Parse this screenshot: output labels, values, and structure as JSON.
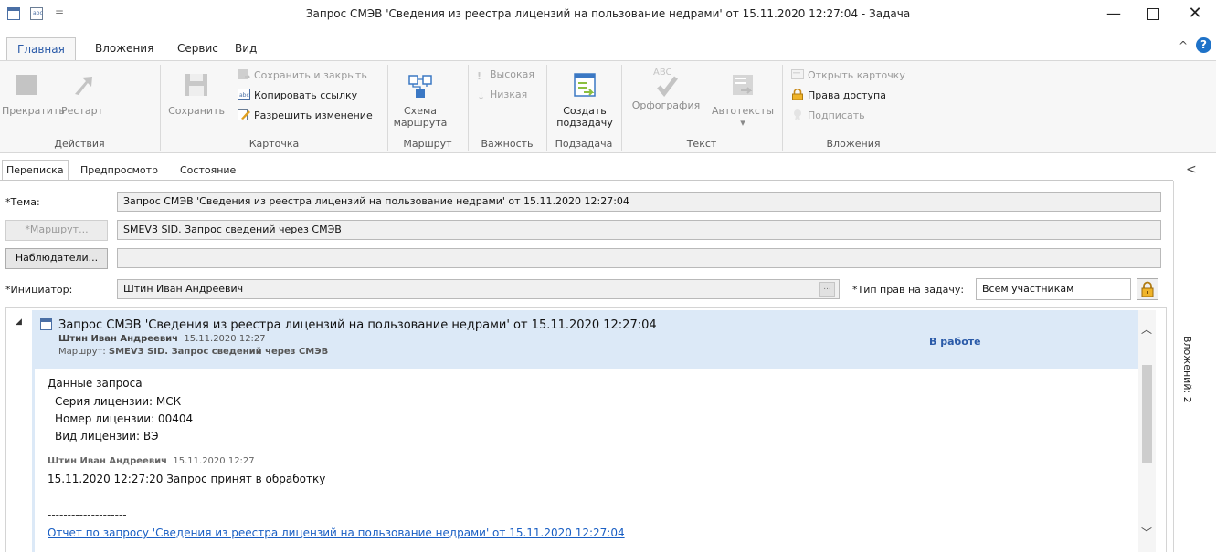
{
  "window": {
    "title": "Запрос СМЭВ 'Сведения из реестра лицензий на пользование недрами' от 15.11.2020 12:27:04 - Задача",
    "qa_separator": "=",
    "minimize": "—",
    "close": "✕"
  },
  "ribbon_tabs": [
    "Главная",
    "Вложения",
    "Сервис",
    "Вид"
  ],
  "ribbon_collapse": "^",
  "help": "?",
  "ribbon": {
    "actions": {
      "stop": "Прекратить",
      "restart": "Рестарт",
      "label": "Действия"
    },
    "card": {
      "save": "Сохранить",
      "save_close": "Сохранить и закрыть",
      "copy_link": "Копировать ссылку",
      "allow_change": "Разрешить изменение",
      "label": "Карточка"
    },
    "route": {
      "scheme_line1": "Схема",
      "scheme_line2": "маршрута",
      "label": "Маршрут"
    },
    "importance": {
      "high": "Высокая",
      "low": "Низкая",
      "label": "Важность"
    },
    "subtask": {
      "create_line1": "Создать",
      "create_line2": "подзадачу",
      "label": "Подзадача"
    },
    "text": {
      "abc": "ABC",
      "spelling": "Орфография",
      "autotext": "Автотексты",
      "autotext_arrow": "▾",
      "label": "Текст"
    },
    "attachments": {
      "open_card": "Открыть карточку",
      "access_rights": "Права доступа",
      "sign": "Подписать",
      "label": "Вложения"
    }
  },
  "content_tabs": [
    "Переписка",
    "Предпросмотр",
    "Состояние"
  ],
  "collapse_arrow": "<",
  "form": {
    "subject_label": "*Тема:",
    "subject_value": "Запрос СМЭВ 'Сведения из реестра лицензий на пользование недрами' от 15.11.2020 12:27:04",
    "route_button": "*Маршрут...",
    "route_value": "SMEV3 SID. Запрос сведений через СМЭВ",
    "observers_button": "Наблюдатели...",
    "observers_value": "",
    "initiator_label": "*Инициатор:",
    "initiator_value": "Штин Иван Андреевич",
    "dots": "...",
    "rights_label": "*Тип прав на задачу:",
    "rights_value": "Всем участникам"
  },
  "message": {
    "expander": "◢",
    "title": "Запрос СМЭВ 'Сведения из реестра лицензий на пользование недрами' от 15.11.2020 12:27:04",
    "author": "Штин Иван Андреевич",
    "date": "15.11.2020 12:27",
    "route_label": "Маршрут:",
    "route_value": "SMEV3 SID. Запрос сведений через СМЭВ",
    "status": "В работе",
    "body": {
      "heading": "Данные запроса",
      "series": "Серия лицензии: МСК",
      "number": "Номер лицензии: 00404",
      "type": "Вид лицензии: ВЭ",
      "reply_author": "Штин Иван Андреевич",
      "reply_date": "15.11.2020 12:27",
      "reply_text": "15.11.2020 12:27:20 Запрос принят в обработку",
      "divider": "--------------------",
      "report_link": "Отчет по запросу 'Сведения из реестра лицензий на пользование недрами' от 15.11.2020 12:27:04"
    }
  },
  "scroll": {
    "up": "︿",
    "down": "﹀"
  },
  "attachments_pane": {
    "label": "Вложений: 2"
  }
}
